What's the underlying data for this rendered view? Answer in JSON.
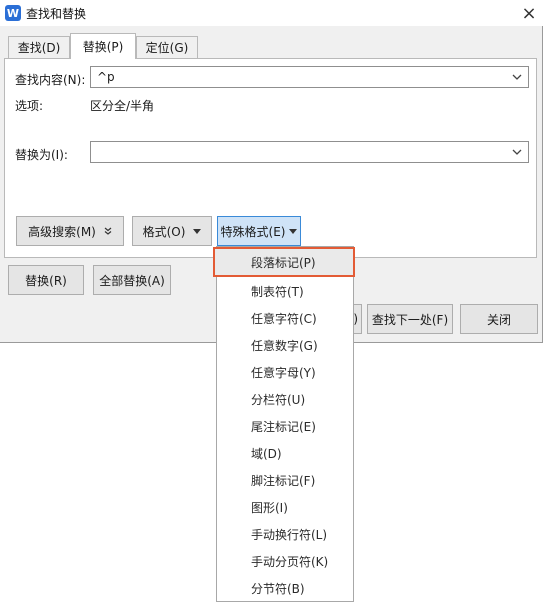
{
  "window": {
    "title": "查找和替换",
    "close_glyph": "×",
    "app_icon_glyph": "W"
  },
  "tabs": [
    {
      "label": "查找(D)"
    },
    {
      "label": "替换(P)",
      "active": true
    },
    {
      "label": "定位(G)"
    }
  ],
  "find": {
    "label": "查找内容(N):",
    "value": "^p"
  },
  "options": {
    "label": "选项:",
    "value": "区分全/半角"
  },
  "replace": {
    "label": "替换为(I):",
    "value": ""
  },
  "buttons": {
    "advanced_search": "高级搜索(M)",
    "format": "格式(O)",
    "special_format": "特殊格式(E)",
    "replace": "替换(R)",
    "replace_all": "全部替换(A)",
    "hidden_partial": "C)",
    "find_next": "查找下一处(F)",
    "close": "关闭"
  },
  "special_menu": {
    "items": [
      "段落标记(P)",
      "制表符(T)",
      "任意字符(C)",
      "任意数字(G)",
      "任意字母(Y)",
      "分栏符(U)",
      "尾注标记(E)",
      "域(D)",
      "脚注标记(F)",
      "图形(I)",
      "手动换行符(L)",
      "手动分页符(K)",
      "分节符(B)"
    ],
    "highlighted_index": 0
  },
  "colors": {
    "highlight_border": "#e35b35",
    "accent": "#2b6fd6"
  }
}
